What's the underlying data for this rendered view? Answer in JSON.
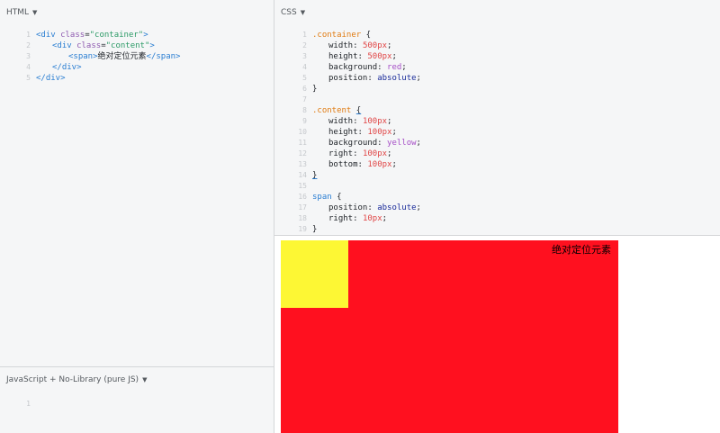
{
  "html_panel": {
    "title": "HTML",
    "lines": [
      {
        "n": "1",
        "parts": [
          "<div ",
          "class",
          "=",
          "\"container\"",
          ">"
        ]
      },
      {
        "n": "2",
        "parts": [
          "<div ",
          "class",
          "=",
          "\"content\"",
          ">"
        ]
      },
      {
        "n": "3",
        "parts": [
          "<span>",
          "绝对定位元素",
          "</span>"
        ]
      },
      {
        "n": "4",
        "parts": [
          "</div>"
        ]
      },
      {
        "n": "5",
        "parts": [
          "</div>"
        ]
      }
    ]
  },
  "css_panel": {
    "title": "CSS",
    "lines": {
      "l1": {
        "n": "1",
        "selector": ".container",
        "brace": " {"
      },
      "l2": {
        "n": "2",
        "prop": "width: ",
        "val": "500px",
        "semi": ";"
      },
      "l3": {
        "n": "3",
        "prop": "height: ",
        "val": "500px",
        "semi": ";"
      },
      "l4": {
        "n": "4",
        "prop": "background: ",
        "val": "red",
        "semi": ";"
      },
      "l5": {
        "n": "5",
        "prop": "position: ",
        "val": "absolute",
        "semi": ";"
      },
      "l6": {
        "n": "6",
        "text": "}"
      },
      "l7": {
        "n": "7",
        "text": ""
      },
      "l8": {
        "n": "8",
        "selector": ".content",
        "brace": "{"
      },
      "l9": {
        "n": "9",
        "prop": "width: ",
        "val": "100px",
        "semi": ";"
      },
      "l10": {
        "n": "10",
        "prop": "height: ",
        "val": "100px",
        "semi": ";"
      },
      "l11": {
        "n": "11",
        "prop": "background: ",
        "val": "yellow",
        "semi": ";"
      },
      "l12": {
        "n": "12",
        "prop": "right: ",
        "val": "100px",
        "semi": ";"
      },
      "l13": {
        "n": "13",
        "prop": "bottom: ",
        "val": "100px",
        "semi": ";"
      },
      "l14": {
        "n": "14",
        "text": "}"
      },
      "l15": {
        "n": "15",
        "text": ""
      },
      "l16": {
        "n": "16",
        "selector": "span",
        "brace": " {"
      },
      "l17": {
        "n": "17",
        "prop": "position: ",
        "val": "absolute",
        "semi": ";"
      },
      "l18": {
        "n": "18",
        "prop": "right: ",
        "val": "10px",
        "semi": ";"
      },
      "l19": {
        "n": "19",
        "text": "}"
      }
    }
  },
  "js_panel": {
    "title": "JavaScript + No-Library (pure JS)",
    "line_number": "1"
  },
  "result": {
    "span_text": "绝对定位元素",
    "container_color": "#ff101f",
    "content_color": "#fdf734"
  }
}
